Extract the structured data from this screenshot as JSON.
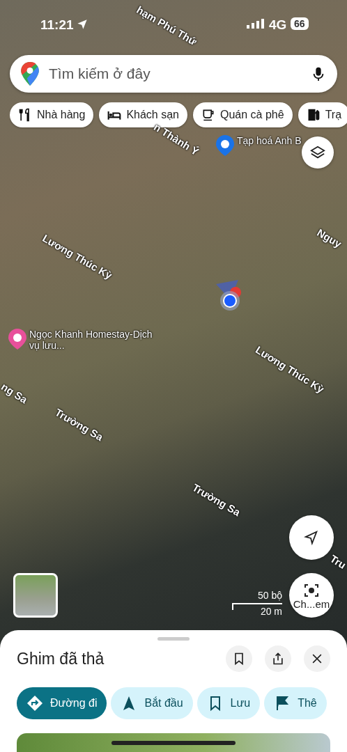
{
  "status_bar": {
    "time": "11:21",
    "network": "4G",
    "battery": "66"
  },
  "search": {
    "placeholder": "Tìm kiếm ở đây"
  },
  "chips": [
    {
      "kind": "restaurant",
      "label": "Nhà hàng"
    },
    {
      "kind": "hotel",
      "label": "Khách sạn"
    },
    {
      "kind": "cafe",
      "label": "Quán cà phê"
    },
    {
      "kind": "fuel",
      "label": "Trạ"
    }
  ],
  "map_labels": [
    {
      "kind": "street",
      "text": "hạm Phú Thứ"
    },
    {
      "kind": "street",
      "text": "n Thành Ý"
    },
    {
      "kind": "place",
      "text": "Tạp hoá Anh B",
      "color": "#1a73e8"
    },
    {
      "kind": "street",
      "text": "Nguy"
    },
    {
      "kind": "street",
      "text": "Lương Thúc Kỳ"
    },
    {
      "kind": "place",
      "text": "Ngọc Khanh Homestay-Dịch vụ lưu...",
      "color": "#e8509b"
    },
    {
      "kind": "street",
      "text": "Lương Thúc Kỳ"
    },
    {
      "kind": "street",
      "text": "ng Sa"
    },
    {
      "kind": "street",
      "text": "Trường Sa"
    },
    {
      "kind": "street",
      "text": "Trường Sa"
    },
    {
      "kind": "street",
      "text": "Tru"
    }
  ],
  "scale": {
    "imperial": "50 bộ",
    "metric": "20 m"
  },
  "lens_button": {
    "label": "Ch...em"
  },
  "sheet": {
    "title": "Ghim đã thả",
    "actions": [
      {
        "kind": "directions",
        "label": "Đường đi",
        "selected": true
      },
      {
        "kind": "start",
        "label": "Bắt đầu",
        "selected": false
      },
      {
        "kind": "save",
        "label": "Lưu",
        "selected": false
      },
      {
        "kind": "flag",
        "label": "Thê",
        "selected": false
      }
    ]
  }
}
